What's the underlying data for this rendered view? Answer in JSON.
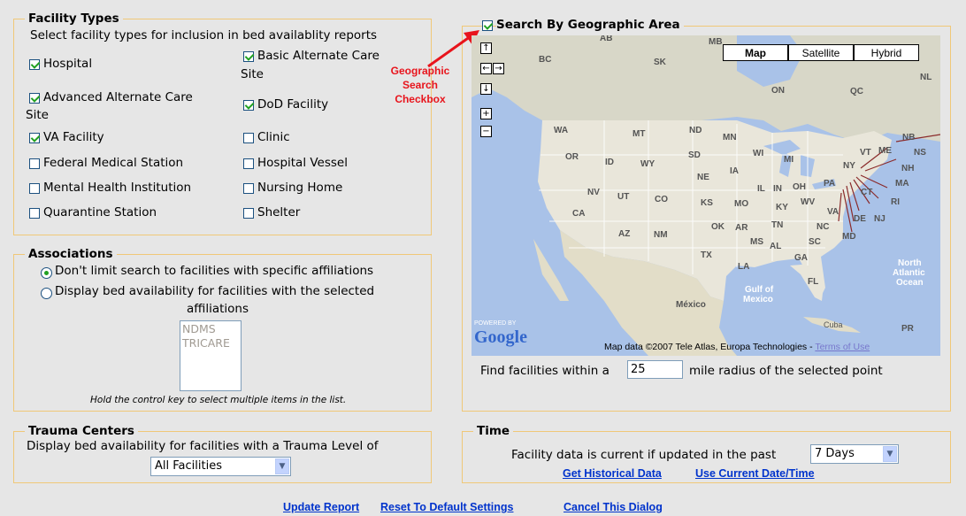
{
  "facility_types": {
    "legend": "Facility Types",
    "description": "Select facility types for inclusion in bed availablity reports",
    "items": [
      {
        "label": "Hospital",
        "checked": true
      },
      {
        "label": "Basic Alternate Care",
        "label2": "Site",
        "checked": true
      },
      {
        "label": "Advanced Alternate Care",
        "label2": "Site",
        "checked": true
      },
      {
        "label": "DoD Facility",
        "checked": true
      },
      {
        "label": "VA Facility",
        "checked": true
      },
      {
        "label": "Clinic",
        "checked": false
      },
      {
        "label": "Federal Medical Station",
        "checked": false
      },
      {
        "label": "Hospital Vessel",
        "checked": false
      },
      {
        "label": "Mental Health Institution",
        "checked": false
      },
      {
        "label": "Nursing Home",
        "checked": false
      },
      {
        "label": "Quarantine Station",
        "checked": false
      },
      {
        "label": "Shelter",
        "checked": false
      }
    ]
  },
  "associations": {
    "legend": "Associations",
    "option1": "Don't limit search to facilities with specific affiliations",
    "option2_line1": "Display bed availability for facilities with the selected",
    "option2_line2": "affiliations",
    "list_items": [
      "NDMS",
      "TRICARE"
    ],
    "hint": "Hold the control key to select multiple items in the list."
  },
  "trauma": {
    "legend": "Trauma Centers",
    "description": "Display bed availability for facilities with a Trauma Level of",
    "selected": "All Facilities"
  },
  "geo": {
    "legend": "Search By Geographic Area",
    "checked": true,
    "annotation": [
      "Geographic",
      "Search",
      "Checkbox"
    ],
    "map_types": [
      "Map",
      "Satellite",
      "Hybrid"
    ],
    "powered_by": "POWERED BY",
    "google": "Google",
    "attribution": "Map data ©2007 Tele Atlas, Europa Technologies - ",
    "terms": "Terms of Use",
    "find_prefix": "Find facilities within a",
    "radius": "25",
    "find_suffix": "mile radius of the selected point",
    "labels": {
      "AB": "AB",
      "MB": "MB",
      "BC": "BC",
      "SK": "SK",
      "NL": "NL",
      "ON": "ON",
      "QC": "QC",
      "WA": "WA",
      "MT": "MT",
      "ND": "ND",
      "MN": "MN",
      "OR": "OR",
      "ID": "ID",
      "WY": "WY",
      "SD": "SD",
      "WI": "WI",
      "MI": "MI",
      "NE": "NE",
      "IA": "IA",
      "NV": "NV",
      "UT": "UT",
      "CO": "CO",
      "KS": "KS",
      "MO": "MO",
      "IL": "IL",
      "IN": "IN",
      "OH": "OH",
      "PA": "PA",
      "NY": "NY",
      "VT": "VT",
      "ME": "ME",
      "NB": "NB",
      "NS": "NS",
      "NH": "NH",
      "MA": "MA",
      "CT": "CT",
      "RI": "RI",
      "WV": "WV",
      "KY": "KY",
      "VA": "VA",
      "DE": "DE",
      "NJ": "NJ",
      "MD": "MD",
      "CA": "CA",
      "AZ": "AZ",
      "NM": "NM",
      "OK": "OK",
      "AR": "AR",
      "TN": "TN",
      "NC": "NC",
      "SC": "SC",
      "TX": "TX",
      "LA": "LA",
      "MS": "MS",
      "AL": "AL",
      "GA": "GA",
      "FL": "FL",
      "Mexico": "México",
      "Gulf1": "Gulf of",
      "Gulf2": "Mexico",
      "Cuba": "Cuba",
      "PR": "PR",
      "North": "North",
      "Atlantic": "Atlantic",
      "Ocean": "Ocean"
    }
  },
  "time": {
    "legend": "Time",
    "description": "Facility data is current if updated in the past",
    "selected": "7 Days",
    "historical": "Get Historical Data",
    "current": "Use Current Date/Time"
  },
  "footer": {
    "update": "Update Report",
    "reset": "Reset To Default Settings",
    "cancel": "Cancel This Dialog"
  }
}
